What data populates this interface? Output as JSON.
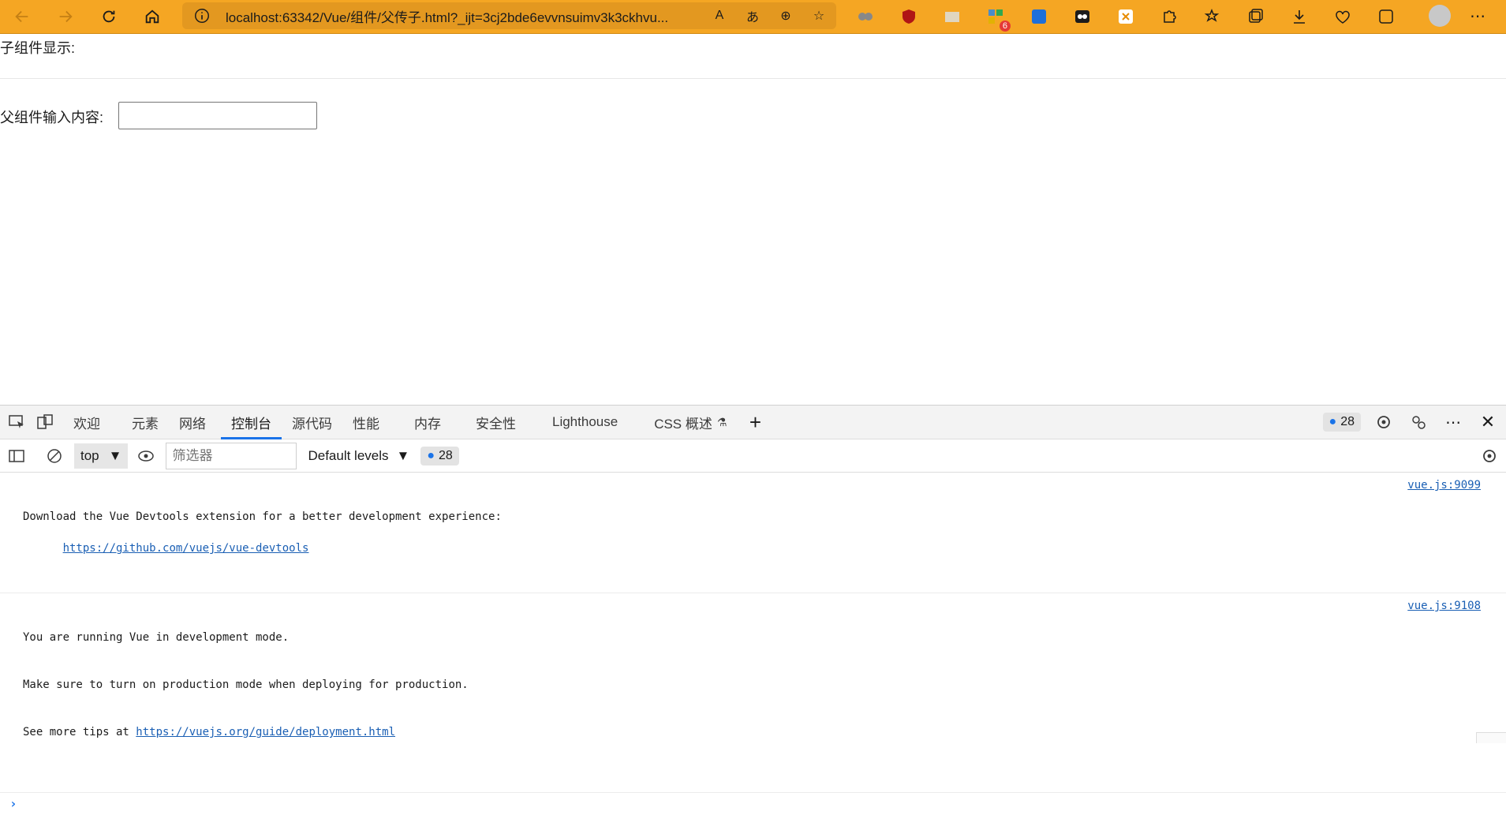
{
  "browser": {
    "url": "localhost:63342/Vue/组件/父传子.html?_ijt=3cj2bde6evvnsuimv3k3ckhvu...",
    "ext_badge": "6"
  },
  "page": {
    "child_label": "子组件显示:",
    "parent_label": "父组件输入内容:",
    "parent_input_value": ""
  },
  "devtools": {
    "tabs": [
      "欢迎",
      "元素",
      "网络",
      "控制台",
      "源代码",
      "性能",
      "内存",
      "安全性",
      "Lighthouse",
      "CSS 概述"
    ],
    "active_tab": "控制台",
    "issues_count": "28",
    "context": "top",
    "filter_placeholder": "筛选器",
    "levels": "Default levels",
    "toolbar_issues": "28",
    "messages": [
      {
        "line1": "Download the Vue Devtools extension for a better development experience:",
        "link": "https://github.com/vuejs/vue-devtools",
        "source": "vue.js:9099"
      },
      {
        "line1": "You are running Vue in development mode.",
        "line2": "Make sure to turn on production mode when deploying for production.",
        "line3_prefix": "See more tips at ",
        "link": "https://vuejs.org/guide/deployment.html",
        "source": "vue.js:9108"
      }
    ],
    "prompt": "›"
  }
}
